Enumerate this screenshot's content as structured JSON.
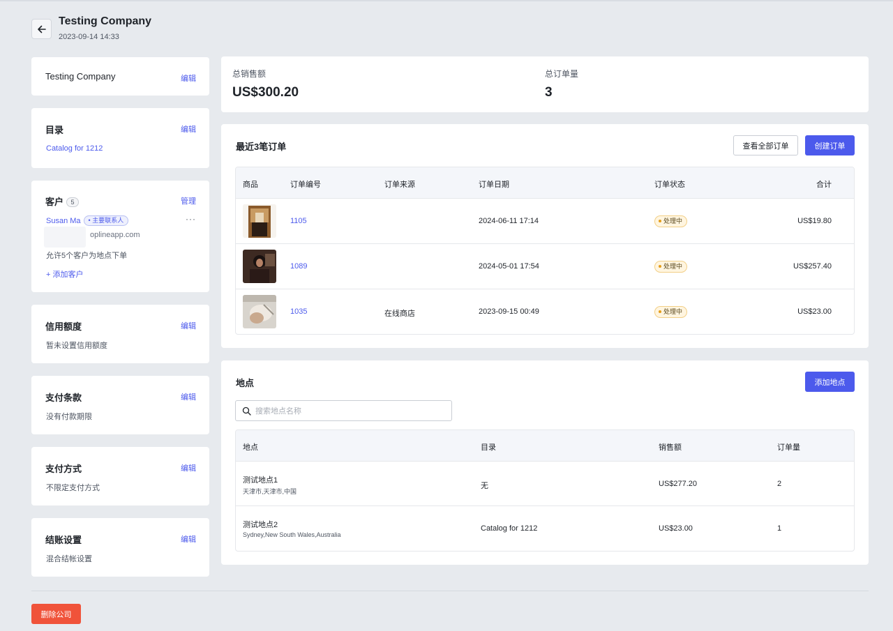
{
  "header": {
    "title": "Testing Company",
    "date": "2023-09-14 14:33"
  },
  "company_card": {
    "name": "Testing Company",
    "edit": "编辑"
  },
  "catalog_card": {
    "title": "目录",
    "edit": "编辑",
    "catalog": "Catalog for 1212"
  },
  "customers_card": {
    "title": "客户",
    "count": "5",
    "manage": "管理",
    "contact_name": "Susan Ma",
    "contact_tag": "主要联系人",
    "more": "···",
    "email_partial": "oplineapp.com",
    "note": "允许5个客户为地点下单",
    "add": "+ 添加客户"
  },
  "credit_card": {
    "title": "信用额度",
    "edit": "编辑",
    "value": "暂未设置信用额度"
  },
  "payment_terms_card": {
    "title": "支付条款",
    "edit": "编辑",
    "value": "没有付款期限"
  },
  "payment_method_card": {
    "title": "支付方式",
    "edit": "编辑",
    "value": "不限定支付方式"
  },
  "checkout_card": {
    "title": "结账设置",
    "edit": "编辑",
    "value": "混合结帐设置"
  },
  "stats": {
    "sales_label": "总销售额",
    "sales_value": "US$300.20",
    "orders_label": "总订单量",
    "orders_value": "3"
  },
  "orders": {
    "title": "最近3笔订单",
    "view_all": "查看全部订单",
    "create": "创建订单",
    "columns": [
      "商品",
      "订单编号",
      "订单来源",
      "订单日期",
      "订单状态",
      "合计"
    ],
    "rows": [
      {
        "id": "1105",
        "source": "",
        "date": "2024-06-11 17:14",
        "status": "处理中",
        "total": "US$19.80"
      },
      {
        "id": "1089",
        "source": "",
        "date": "2024-05-01 17:54",
        "status": "处理中",
        "total": "US$257.40"
      },
      {
        "id": "1035",
        "source": "在线商店",
        "date": "2023-09-15 00:49",
        "status": "处理中",
        "total": "US$23.00"
      }
    ]
  },
  "locations": {
    "title": "地点",
    "add": "添加地点",
    "search_placeholder": "搜索地点名称",
    "columns": [
      "地点",
      "目录",
      "销售额",
      "订单量"
    ],
    "rows": [
      {
        "name": "测试地点1",
        "address": "天津市,天津市,中国",
        "catalog": "无",
        "sales": "US$277.20",
        "orders": "2"
      },
      {
        "name": "测试地点2",
        "address": "Sydney,New South Wales,Australia",
        "catalog": "Catalog for 1212",
        "sales": "US$23.00",
        "orders": "1"
      }
    ]
  },
  "delete_button": "删除公司",
  "colors": {
    "accent": "#4c5aec",
    "danger": "#f0533a",
    "background": "#e7eaee",
    "status_bg": "#fff5e0"
  },
  "icons": {
    "back": "arrow-left-icon",
    "search": "search-icon",
    "more": "more-horizontal-icon"
  }
}
